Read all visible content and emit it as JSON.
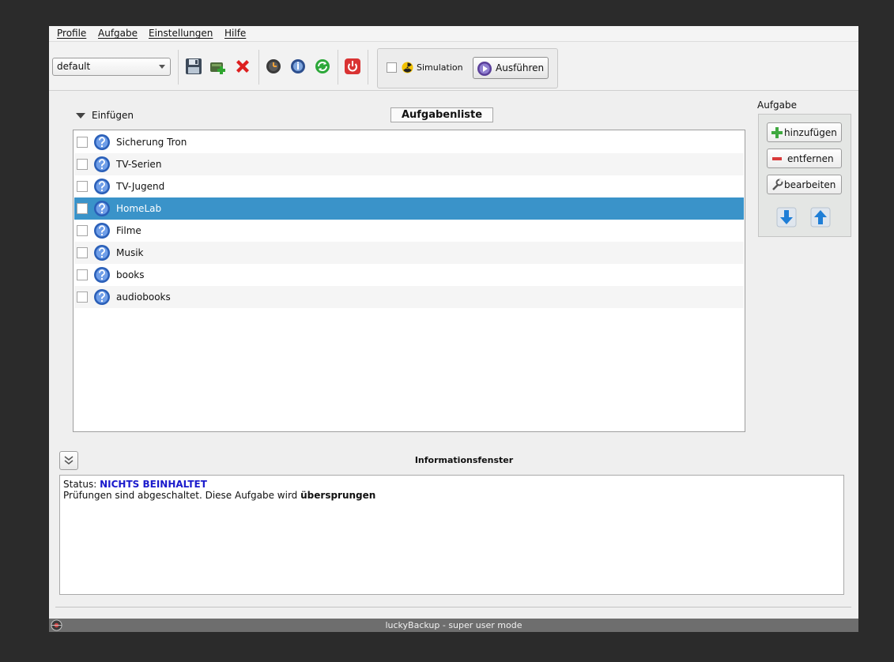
{
  "menubar": {
    "items": [
      "Profile",
      "Aufgabe",
      "Einstellungen",
      "Hilfe"
    ]
  },
  "toolbar": {
    "profile_selected": "default",
    "simulation_label": "Simulation",
    "run_label": "Ausführen"
  },
  "tasks": {
    "insert_label": "Einfügen",
    "list_title": "Aufgabenliste",
    "items": [
      {
        "label": "Sicherung Tron",
        "checked": false,
        "selected": false
      },
      {
        "label": "TV-Serien",
        "checked": false,
        "selected": false
      },
      {
        "label": "TV-Jugend",
        "checked": false,
        "selected": false
      },
      {
        "label": "HomeLab",
        "checked": false,
        "selected": true
      },
      {
        "label": "Filme",
        "checked": false,
        "selected": false
      },
      {
        "label": "Musik",
        "checked": false,
        "selected": false
      },
      {
        "label": "books",
        "checked": false,
        "selected": false
      },
      {
        "label": "audiobooks",
        "checked": false,
        "selected": false
      }
    ]
  },
  "task_panel": {
    "title": "Aufgabe",
    "add_label": "hinzufügen",
    "remove_label": "entfernen",
    "edit_label": "bearbeiten"
  },
  "info": {
    "title": "Informationsfenster",
    "status_label": "Status:",
    "status_value": "NICHTS BEINHALTET",
    "message_prefix": "Prüfungen sind abgeschaltet. Diese Aufgabe wird",
    "message_emphasis": "übersprungen"
  },
  "window": {
    "status_title": "luckyBackup - super user mode"
  },
  "colors": {
    "selection": "#3a93c9",
    "status_value": "#1a1acc",
    "remove_red": "#d93a3a",
    "add_green": "#3fa83f"
  }
}
